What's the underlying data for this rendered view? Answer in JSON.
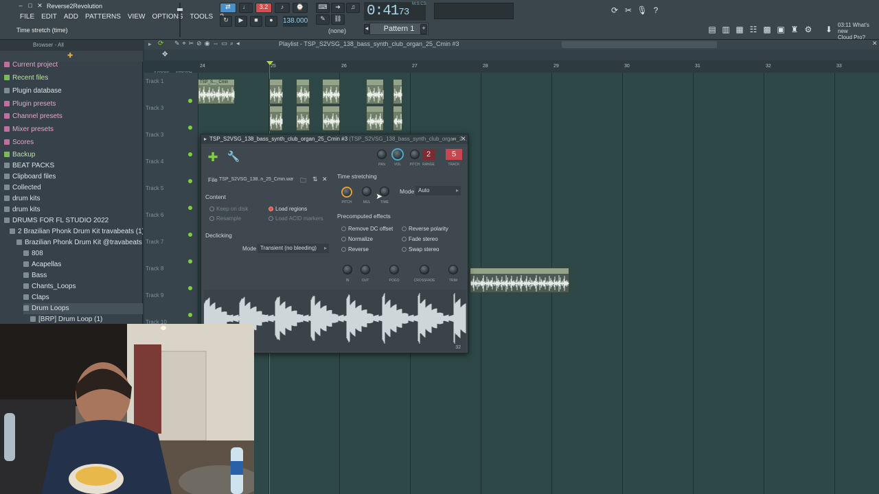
{
  "window": {
    "project_title": "Reverse2Revolution",
    "hint": "Time stretch (time)"
  },
  "menu": [
    "FILE",
    "EDIT",
    "ADD",
    "PATTERNS",
    "VIEW",
    "OPTIONS",
    "TOOLS",
    "?"
  ],
  "transport": {
    "time": "0:41",
    "time_frac": "73",
    "time_unit": "M:S:CS",
    "tempo": "138.000",
    "pattern": "Pattern 1",
    "none_label": "(none)",
    "counter": "3.2"
  },
  "news": {
    "time": "03:11",
    "text1": "What's new",
    "text2": "Cloud Pro?"
  },
  "browser": {
    "header": "Browser - All",
    "items": [
      {
        "label": "Current project",
        "color": "pink"
      },
      {
        "label": "Recent files",
        "color": "green"
      },
      {
        "label": "Plugin database",
        "color": "white"
      },
      {
        "label": "Plugin presets",
        "color": "pink"
      },
      {
        "label": "Channel presets",
        "color": "pink"
      },
      {
        "label": "Mixer presets",
        "color": "pink"
      },
      {
        "label": "Scores",
        "color": "pink"
      },
      {
        "label": "Backup",
        "color": "green"
      },
      {
        "label": "BEAT PACKS",
        "color": "white"
      },
      {
        "label": "Clipboard files",
        "color": "white"
      },
      {
        "label": "Collected",
        "color": "white"
      },
      {
        "label": "drum kits",
        "color": "white"
      },
      {
        "label": "drum kits",
        "color": "white"
      },
      {
        "label": "DRUMS FOR FL STUDIO 2022",
        "color": "white"
      },
      {
        "label": "2 Brazilian Phonk Drum Kit travabeats (1)",
        "color": "white"
      },
      {
        "label": "Brazilian Phonk Drum Kit @travabeats",
        "color": "white"
      },
      {
        "label": "808",
        "color": "white"
      },
      {
        "label": "Acapellas",
        "color": "white"
      },
      {
        "label": "Bass",
        "color": "white"
      },
      {
        "label": "Chants_Loops",
        "color": "white"
      },
      {
        "label": "Claps",
        "color": "white"
      },
      {
        "label": "Drum Loops",
        "color": "white"
      },
      {
        "label": "[BRP] Drum Loop (1)",
        "color": "white"
      }
    ]
  },
  "playlist": {
    "title": "Playlist - TSP_S2VSG_138_bass_synth_club_organ_25_Cmin #3",
    "bars": [
      "24",
      "25",
      "26",
      "27",
      "28",
      "29",
      "30",
      "31",
      "32",
      "33"
    ],
    "tracks": [
      "Track 1",
      "Track 3",
      "Track 3",
      "Track 4",
      "Track 5",
      "Track 6",
      "Track 7",
      "Track 8",
      "Track 9",
      "Track 10"
    ],
    "mode_labels": [
      "Z-CROSS",
      "STRETCH"
    ],
    "clip_label": "TSP_S..._Cmin"
  },
  "channel": {
    "title": "TSP_S2VSG_138_bass_synth_club_organ_25_Cmin #3",
    "title_suffix": "(TSP_S2VSG_138_bass_synth_club_organ_2...",
    "knob_labels": [
      "PAN",
      "VOL",
      "PITCH",
      "RANGE",
      "TRACK"
    ],
    "range_value": "2",
    "track_value": "5",
    "file_label": "File",
    "file_name": "TSP_S2VSG_138..n_25_Cmin.wav",
    "content_label": "Content",
    "keep_on_disk": "Keep on disk",
    "resample": "Resample",
    "load_regions": "Load regions",
    "load_acid": "Load ACID markers",
    "declicking_label": "Declicking",
    "mode_label": "Mode",
    "declick_mode": "Transient (no bleeding)",
    "time_stretching_label": "Time stretching",
    "ts_knobs": [
      "PITCH",
      "MUL",
      "TIME"
    ],
    "ts_mode_label": "Mode",
    "ts_mode": "Auto",
    "precomputed_label": "Precomputed effects",
    "effects_left": [
      "Remove DC offset",
      "Normalize",
      "Reverse"
    ],
    "effects_right": [
      "Reverse polarity",
      "Fade stereo",
      "Swap stereo"
    ],
    "bottom_knobs": [
      "IN",
      "OUT",
      "POGO",
      "CROSSFADE",
      "TRIM"
    ],
    "wave_footer": "32"
  },
  "colors": {
    "accent": "#e0584f",
    "playlist_bg": "#2d4846",
    "led": "#7cd13a"
  }
}
